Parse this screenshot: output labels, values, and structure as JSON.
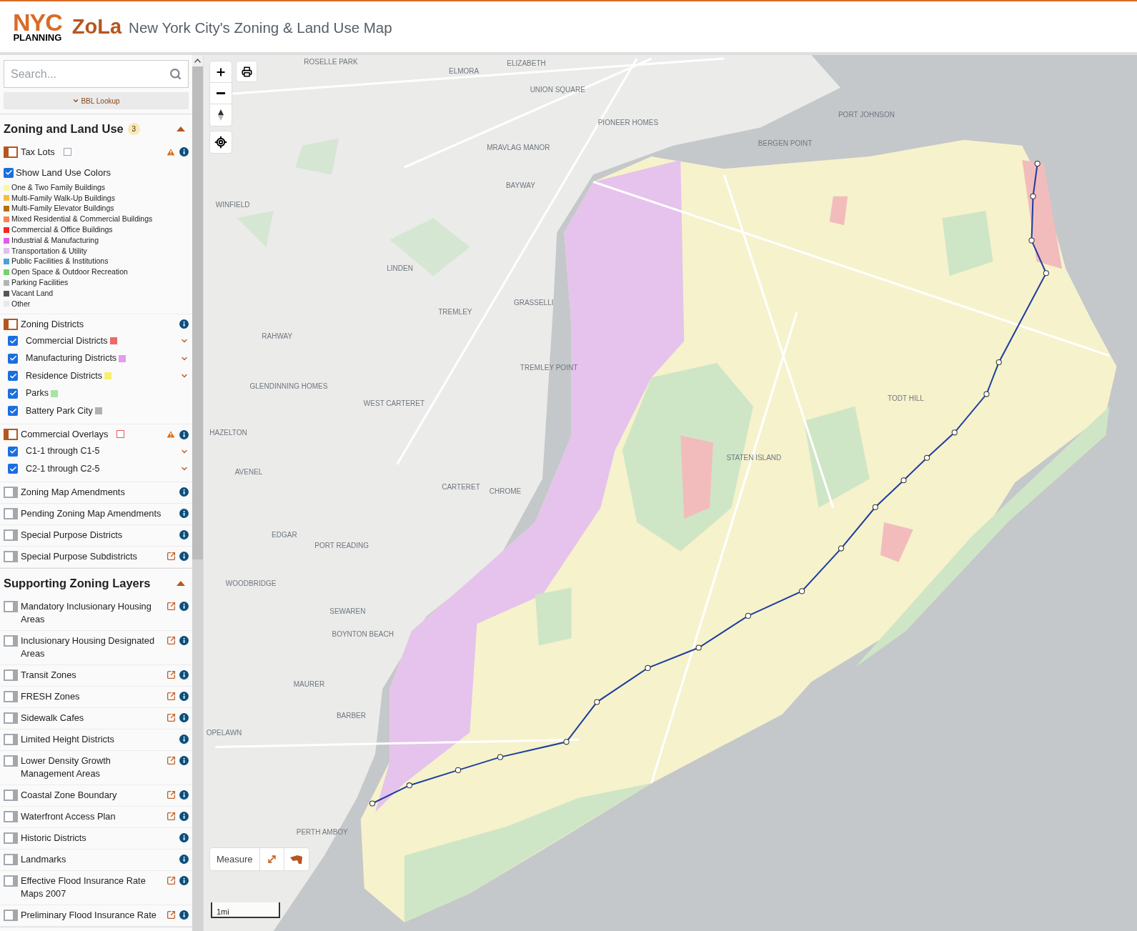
{
  "header": {
    "logo_top": "NYC",
    "logo_bottom": "PLANNING",
    "app_name": "ZoLa",
    "title": "New York City's Zoning & Land Use Map"
  },
  "search": {
    "placeholder": "Search..."
  },
  "bbl_lookup": {
    "label": "BBL Lookup",
    "expanded": false
  },
  "sections": [
    {
      "title": "Zoning and Land Use",
      "badge": "3",
      "expanded": true,
      "layers": [
        {
          "label": "Tax Lots",
          "on": true,
          "color": "#9ca3af",
          "warning": true,
          "external": false,
          "info": true,
          "land_use": {
            "label": "Show Land Use Colors",
            "checked": true,
            "legend": [
              {
                "label": "One & Two Family Buildings",
                "color": "#fbf7a2"
              },
              {
                "label": "Multi-Family Walk-Up Buildings",
                "color": "#f8bb45"
              },
              {
                "label": "Multi-Family Elevator Buildings",
                "color": "#b56f0a"
              },
              {
                "label": "Mixed Residential & Commercial Buildings",
                "color": "#f9834f"
              },
              {
                "label": "Commercial & Office Buildings",
                "color": "#f22828"
              },
              {
                "label": "Industrial & Manufacturing",
                "color": "#e259f2"
              },
              {
                "label": "Transportation & Utility",
                "color": "#e2c0ed"
              },
              {
                "label": "Public Facilities & Institutions",
                "color": "#4aa1d6"
              },
              {
                "label": "Open Space & Outdoor Recreation",
                "color": "#77d16e"
              },
              {
                "label": "Parking Facilities",
                "color": "#b4b4b4"
              },
              {
                "label": "Vacant Land",
                "color": "#565656"
              },
              {
                "label": "Other",
                "color": "#e8e8e8"
              }
            ]
          }
        },
        {
          "label": "Zoning Districts",
          "on": true,
          "warning": false,
          "external": false,
          "info": true,
          "sublayers": [
            {
              "label": "Commercial Districts",
              "checked": true,
              "color": "#f06767",
              "dropdown": true
            },
            {
              "label": "Manufacturing Districts",
              "checked": true,
              "color": "#e29ded",
              "dropdown": true
            },
            {
              "label": "Residence Districts",
              "checked": true,
              "color": "#f8ef6c",
              "dropdown": true
            },
            {
              "label": "Parks",
              "checked": true,
              "color": "#a6e3a4",
              "dropdown": false
            },
            {
              "label": "Battery Park City",
              "checked": true,
              "color": "#b0b0b0",
              "dropdown": false
            }
          ]
        },
        {
          "label": "Commercial Overlays",
          "on": true,
          "color": "#e35b5b",
          "warning": true,
          "external": false,
          "info": true,
          "sublayers": [
            {
              "label": "C1-1 through C1-5",
              "checked": true,
              "dropdown": true
            },
            {
              "label": "C2-1 through C2-5",
              "checked": true,
              "dropdown": true
            }
          ]
        },
        {
          "label": "Zoning Map Amendments",
          "on": false,
          "warning": false,
          "external": false,
          "info": true
        },
        {
          "label": "Pending Zoning Map Amendments",
          "on": false,
          "warning": false,
          "external": false,
          "info": true
        },
        {
          "label": "Special Purpose Districts",
          "on": false,
          "warning": false,
          "external": false,
          "info": true
        },
        {
          "label": "Special Purpose Subdistricts",
          "on": false,
          "warning": false,
          "external": true,
          "info": true
        }
      ]
    },
    {
      "title": "Supporting Zoning Layers",
      "expanded": true,
      "layers": [
        {
          "label": "Mandatory Inclusionary Housing Areas",
          "on": false,
          "warning": false,
          "external": true,
          "info": true
        },
        {
          "label": "Inclusionary Housing Designated Areas",
          "on": false,
          "warning": false,
          "external": true,
          "info": true
        },
        {
          "label": "Transit Zones",
          "on": false,
          "warning": false,
          "external": true,
          "info": true
        },
        {
          "label": "FRESH Zones",
          "on": false,
          "warning": false,
          "external": true,
          "info": true
        },
        {
          "label": "Sidewalk Cafes",
          "on": false,
          "warning": false,
          "external": true,
          "info": true
        },
        {
          "label": "Limited Height Districts",
          "on": false,
          "warning": false,
          "external": false,
          "info": true
        },
        {
          "label": "Lower Density Growth Management Areas",
          "on": false,
          "warning": false,
          "external": true,
          "info": true
        },
        {
          "label": "Coastal Zone Boundary",
          "on": false,
          "warning": false,
          "external": true,
          "info": true
        },
        {
          "label": "Waterfront Access Plan",
          "on": false,
          "warning": false,
          "external": true,
          "info": true
        },
        {
          "label": "Historic Districts",
          "on": false,
          "warning": false,
          "external": false,
          "info": true
        },
        {
          "label": "Landmarks",
          "on": false,
          "warning": false,
          "external": false,
          "info": true
        },
        {
          "label": "Effective Flood Insurance Rate Maps 2007",
          "on": false,
          "warning": false,
          "external": true,
          "info": true
        },
        {
          "label": "Preliminary Flood Insurance Rate",
          "on": false,
          "warning": false,
          "external": true,
          "info": true
        }
      ]
    }
  ],
  "map": {
    "labels": [
      "ROSELLE PARK",
      "ELMORA",
      "ELIZABETH",
      "UNION SQUARE",
      "PORT JOHNSON",
      "PIONEER HOMES",
      "BERGEN POINT",
      "MRAVLAG MANOR",
      "BAYWAY",
      "WINFIELD",
      "LINDEN",
      "GRASSELLI",
      "TREMLEY",
      "RAHWAY",
      "TREMLEY POINT",
      "TODT HILL",
      "GLENDINNING HOMES",
      "WEST CARTERET",
      "STATEN ISLAND",
      "HAZELTON",
      "CARTERET",
      "CHROME",
      "AVENEL",
      "EDGAR",
      "PORT READING",
      "WOODBRIDGE",
      "SEWAREN",
      "BOYNTON BEACH",
      "MAURER",
      "BARBER",
      "OPELAWN",
      "PERTH AMBOY"
    ],
    "measure": {
      "label": "Measure"
    },
    "scale": "1mi"
  }
}
